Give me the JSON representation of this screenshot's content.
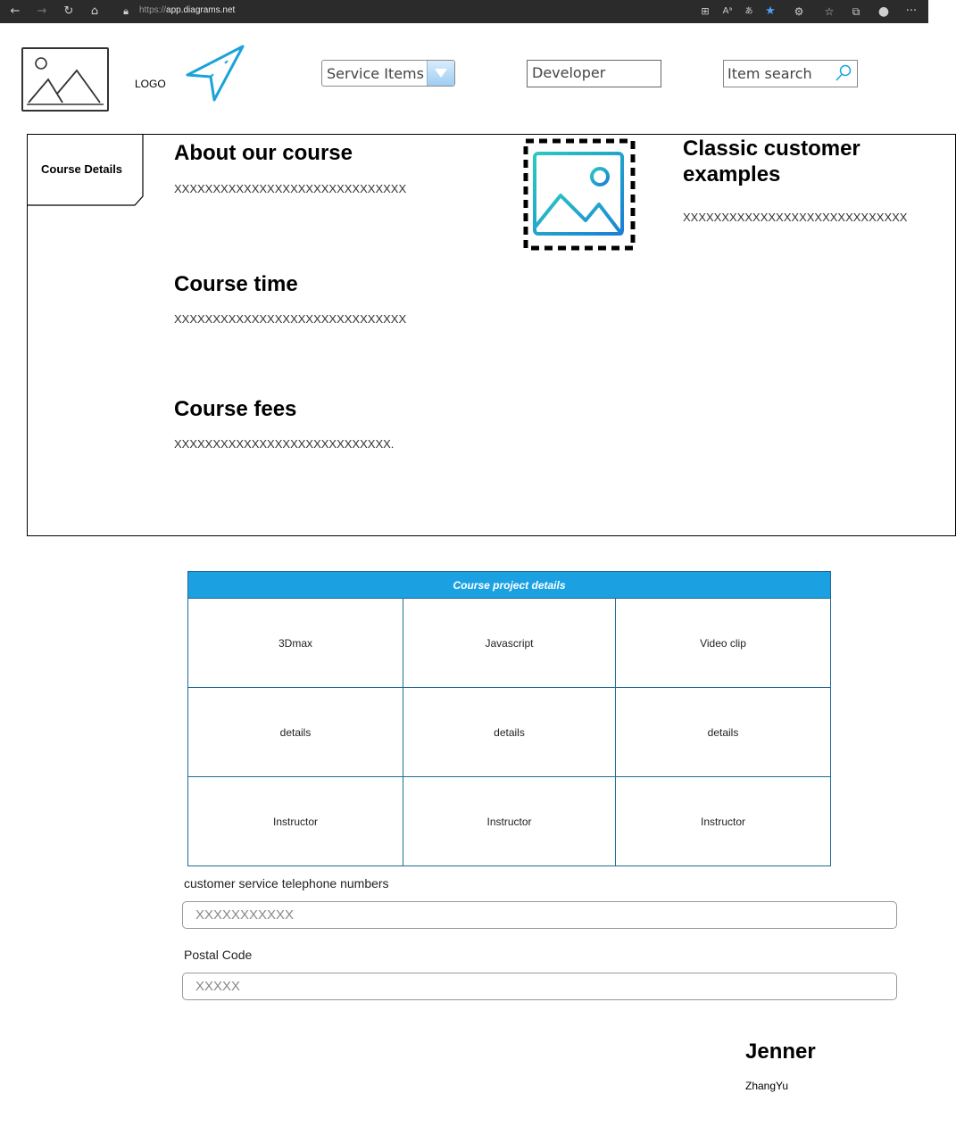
{
  "browser": {
    "url_protocol": "https://",
    "url_host": "app.diagrams.net",
    "nav": [
      "back-icon",
      "forward-icon",
      "refresh-icon",
      "home-icon",
      "lock-icon"
    ],
    "toolbar_icons": [
      "grid-icon",
      "read-aloud-icon",
      "translate-icon",
      "favorite-star-icon",
      "extensions-icon",
      "favorites-icon",
      "collections-icon",
      "profile-icon",
      "more-icon"
    ]
  },
  "header": {
    "logo_text": "LOGO",
    "service_select": "Service Items",
    "developer_value": "Developer",
    "search_value": "Item search"
  },
  "course": {
    "tab_label": "Course Details",
    "about_title": "About our course",
    "about_text": "XXXXXXXXXXXXXXXXXXXXXXXXXXXXXX",
    "time_title": "Course time",
    "time_text": "XXXXXXXXXXXXXXXXXXXXXXXXXXXXXX",
    "fees_title": "Course fees",
    "fees_text": "XXXXXXXXXXXXXXXXXXXXXXXXXXXX.",
    "examples_title": "Classic customer examples",
    "examples_text": "XXXXXXXXXXXXXXXXXXXXXXXXXXXXX"
  },
  "table": {
    "title": "Course project details",
    "rows": [
      [
        "3Dmax",
        "Javascript",
        "Video clip"
      ],
      [
        "details",
        "details",
        "details"
      ],
      [
        "Instructor",
        "Instructor",
        "Instructor"
      ]
    ]
  },
  "form": {
    "phone_label": "customer service telephone numbers",
    "phone_placeholder": "XXXXXXXXXXX",
    "postal_label": "Postal Code",
    "postal_placeholder": "XXXXX"
  },
  "footer": {
    "name": "Jenner",
    "sub": "ZhangYu"
  },
  "colors": {
    "accent": "#1ba1e2",
    "table_border": "#1f6b94",
    "browser_bar": "#2b2b2b"
  }
}
